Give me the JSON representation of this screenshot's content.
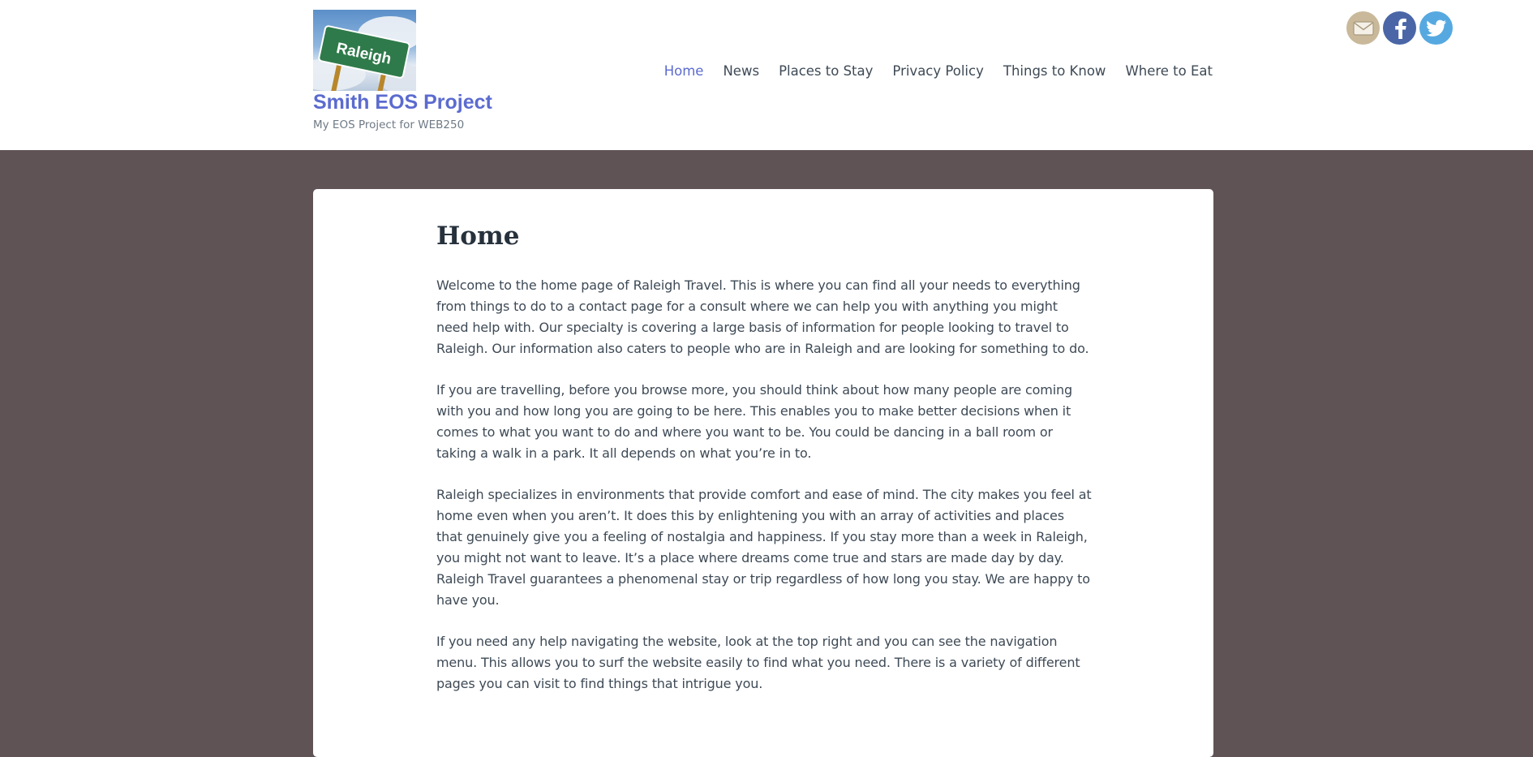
{
  "header": {
    "site_title": "Smith EOS Project",
    "tagline": "My EOS Project for WEB250",
    "logo_sign_text": "Raleigh"
  },
  "nav": {
    "items": [
      {
        "label": "Home",
        "current": true
      },
      {
        "label": "News",
        "current": false
      },
      {
        "label": "Places to Stay",
        "current": false
      },
      {
        "label": "Privacy Policy",
        "current": false
      },
      {
        "label": "Things to Know",
        "current": false
      },
      {
        "label": "Where to Eat",
        "current": false
      }
    ],
    "accent_color": "#5b6bcf"
  },
  "social": [
    {
      "icon": "email-icon",
      "color": "#c9b99a"
    },
    {
      "icon": "facebook-icon",
      "color": "#4a66a6"
    },
    {
      "icon": "twitter-icon",
      "color": "#56a9e0"
    }
  ],
  "page": {
    "title": "Home",
    "paragraphs": [
      "Welcome to the home page of Raleigh Travel. This is where you can find all your needs to everything from things to do to a contact page for a consult where we can help you with anything you might need help with. Our specialty is covering a large basis of information for people looking to travel to Raleigh. Our information also caters to people who are in Raleigh and are looking for something to do.",
      "If you are travelling, before you browse more, you should think about how many people are coming with you and how long you are going to be here. This enables you to make better decisions when it comes to what you want to do and where you want to be. You could be dancing in a ball room or taking a walk in a park. It all depends on what you’re in to.",
      "Raleigh specializes in environments that provide comfort and ease of mind. The city makes you feel at home even when you aren’t. It does this by enlightening you with an array of activities and places that genuinely give you a feeling of nostalgia and happiness. If you stay more than a week in Raleigh, you might not want to leave. It’s a place where dreams come true and stars are made day by day. Raleigh Travel guarantees a phenomenal stay or trip regardless of how long you stay. We are happy to have you.",
      "If you need any help navigating the website, look at the top right and you can see the navigation menu. This allows you to surf the website easily to find what you need. There is a variety of different pages you can visit to find things that intrigue you."
    ]
  },
  "colors": {
    "background": "#5f5356",
    "header_bg": "#ffffff",
    "text": "#3e4a56"
  }
}
